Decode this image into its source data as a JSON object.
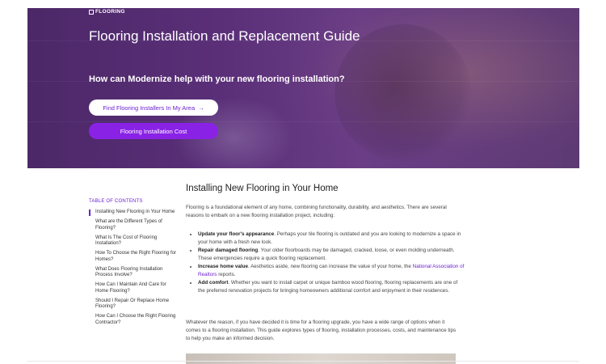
{
  "logo": {
    "text": "FLOORING"
  },
  "hero": {
    "title": "Flooring Installation and Replacement Guide",
    "subtitle": "How can Modernize help with your new flooring installation?",
    "btn_find": "Find Flooring Installers In My Area",
    "btn_find_icon": "arrow-right",
    "btn_cost": "Flooring Installation Cost"
  },
  "toc": {
    "title": "TABLE OF CONTENTS",
    "items": [
      "Installing New Flooring in Your Home",
      "What are the Different Types of Flooring?",
      "What Is The Cost of Flooring Installation?",
      "How To Choose the Right Flooring for Homes?",
      "What Does Flooring Installation Process Involve?",
      "How Can I Maintain And Care for Home Flooring?",
      "Should I Repair Or Replace Home Flooring?",
      "How Can I Choose the Right Flooring Contractor?"
    ]
  },
  "article": {
    "title": "Installing New Flooring in Your Home",
    "intro": "Flooring is a foundational element of any home, combining functionality, durability, and aesthetics. There are several reasons to embark on a new flooring installation project, including:",
    "bullets": [
      {
        "bold": "Update your floor's appearance",
        "text": ". Perhaps your tile flooring is outdated and you are looking to modernize a space in your home with a fresh new look."
      },
      {
        "bold": "Repair damaged flooring",
        "text": ". Your older floorboards may be damaged, cracked, loose, or even molding underneath. These emergencies require a quick flooring replacement."
      },
      {
        "bold": "Increase home value",
        "text": ". Aesthetics aside, new flooring can increase the value of your home, the ",
        "link": "National Association of Realtors",
        "tail": " reports."
      },
      {
        "bold": "Add comfort",
        "text": ". Whether you want to install carpet or unique bamboo wood flooring, flooring replacements are one of the preferred renovation projects for bringing homeowners additional comfort and enjoyment in their residences."
      }
    ],
    "outro": "Whatever the reason, if you have decided it is time for a flooring upgrade, you have a wide range of options when it comes to a flooring installation. This guide explores types of flooring, installation processes, costs, and maintenance tips to help you make an informed decision."
  },
  "colors": {
    "accent": "#8a22e6",
    "link": "#6b1fd1",
    "hero_overlay": "#5a2f78"
  }
}
